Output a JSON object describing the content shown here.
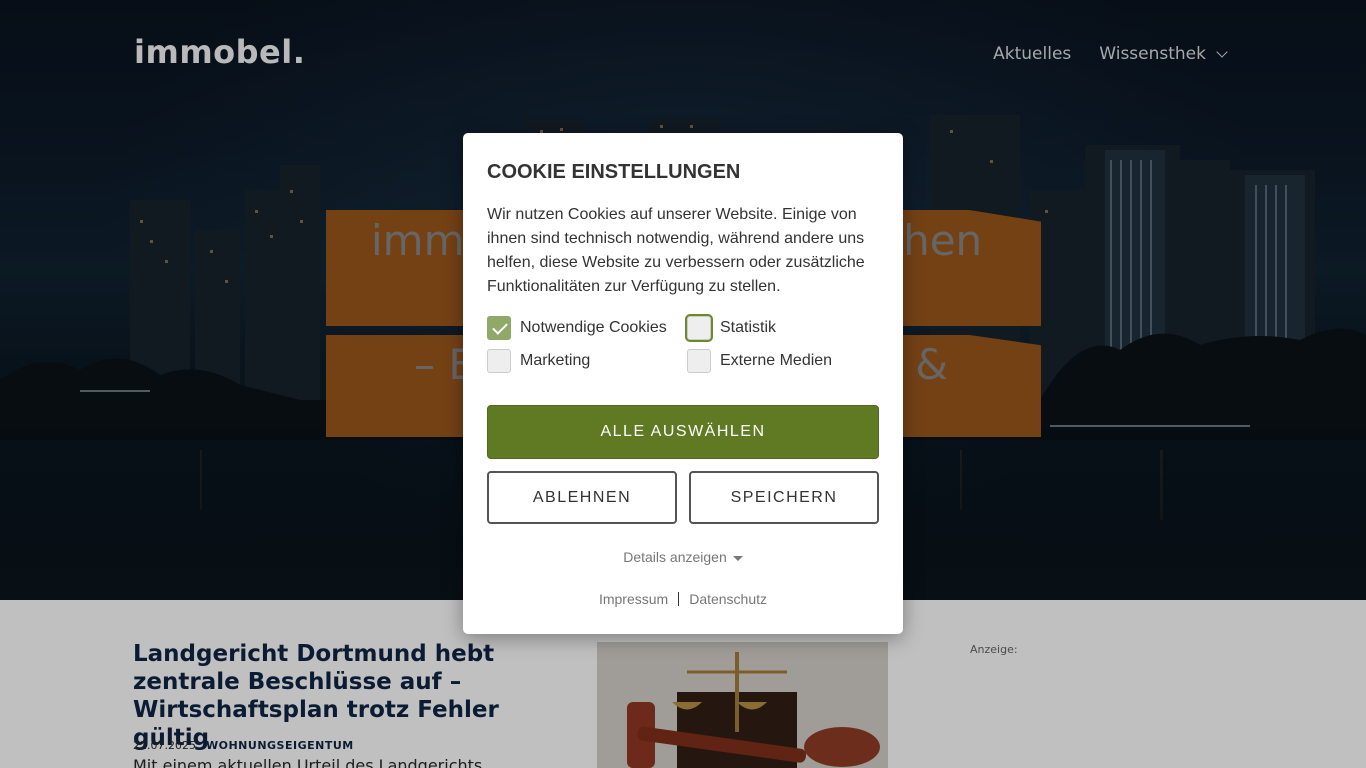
{
  "header": {
    "logo": "immobel.",
    "nav": [
      {
        "label": "Aktuelles"
      },
      {
        "label": "Wissensthek"
      }
    ]
  },
  "hero": {
    "line1_left": "imm",
    "line1_right": "chen",
    "line2_left": "– E",
    "line2_right": "s &"
  },
  "article": {
    "title": "Landgericht Dortmund hebt zentrale Beschlüsse auf – Wirtschaftsplan trotz Fehler gültig",
    "date": "22.07.2025",
    "category": "WOHNUNGSEIGENTUM",
    "excerpt": "Mit einem aktuellen Urteil des Landgerichts"
  },
  "sidebar": {
    "ad_label": "Anzeige:"
  },
  "cookie_modal": {
    "title": "COOKIE EINSTELLUNGEN",
    "text": "Wir nutzen Cookies auf unserer Website. Einige von ihnen sind technisch notwendig, während andere uns helfen, diese Website zu verbessern oder zusätzliche Funktionalitäten zur Verfügung zu stellen.",
    "checkboxes": [
      {
        "label": "Notwendige Cookies",
        "checked": true
      },
      {
        "label": "Statistik",
        "checked": false
      },
      {
        "label": "Marketing",
        "checked": false
      },
      {
        "label": "Externe Medien",
        "checked": false
      }
    ],
    "accept_all_label": "ALLE AUSWÄHLEN",
    "reject_label": "ABLEHNEN",
    "save_label": "SPEICHERN",
    "details_label": "Details anzeigen",
    "impressum_label": "Impressum",
    "datenschutz_label": "Datenschutz",
    "accent_color": "#5f7a23"
  }
}
